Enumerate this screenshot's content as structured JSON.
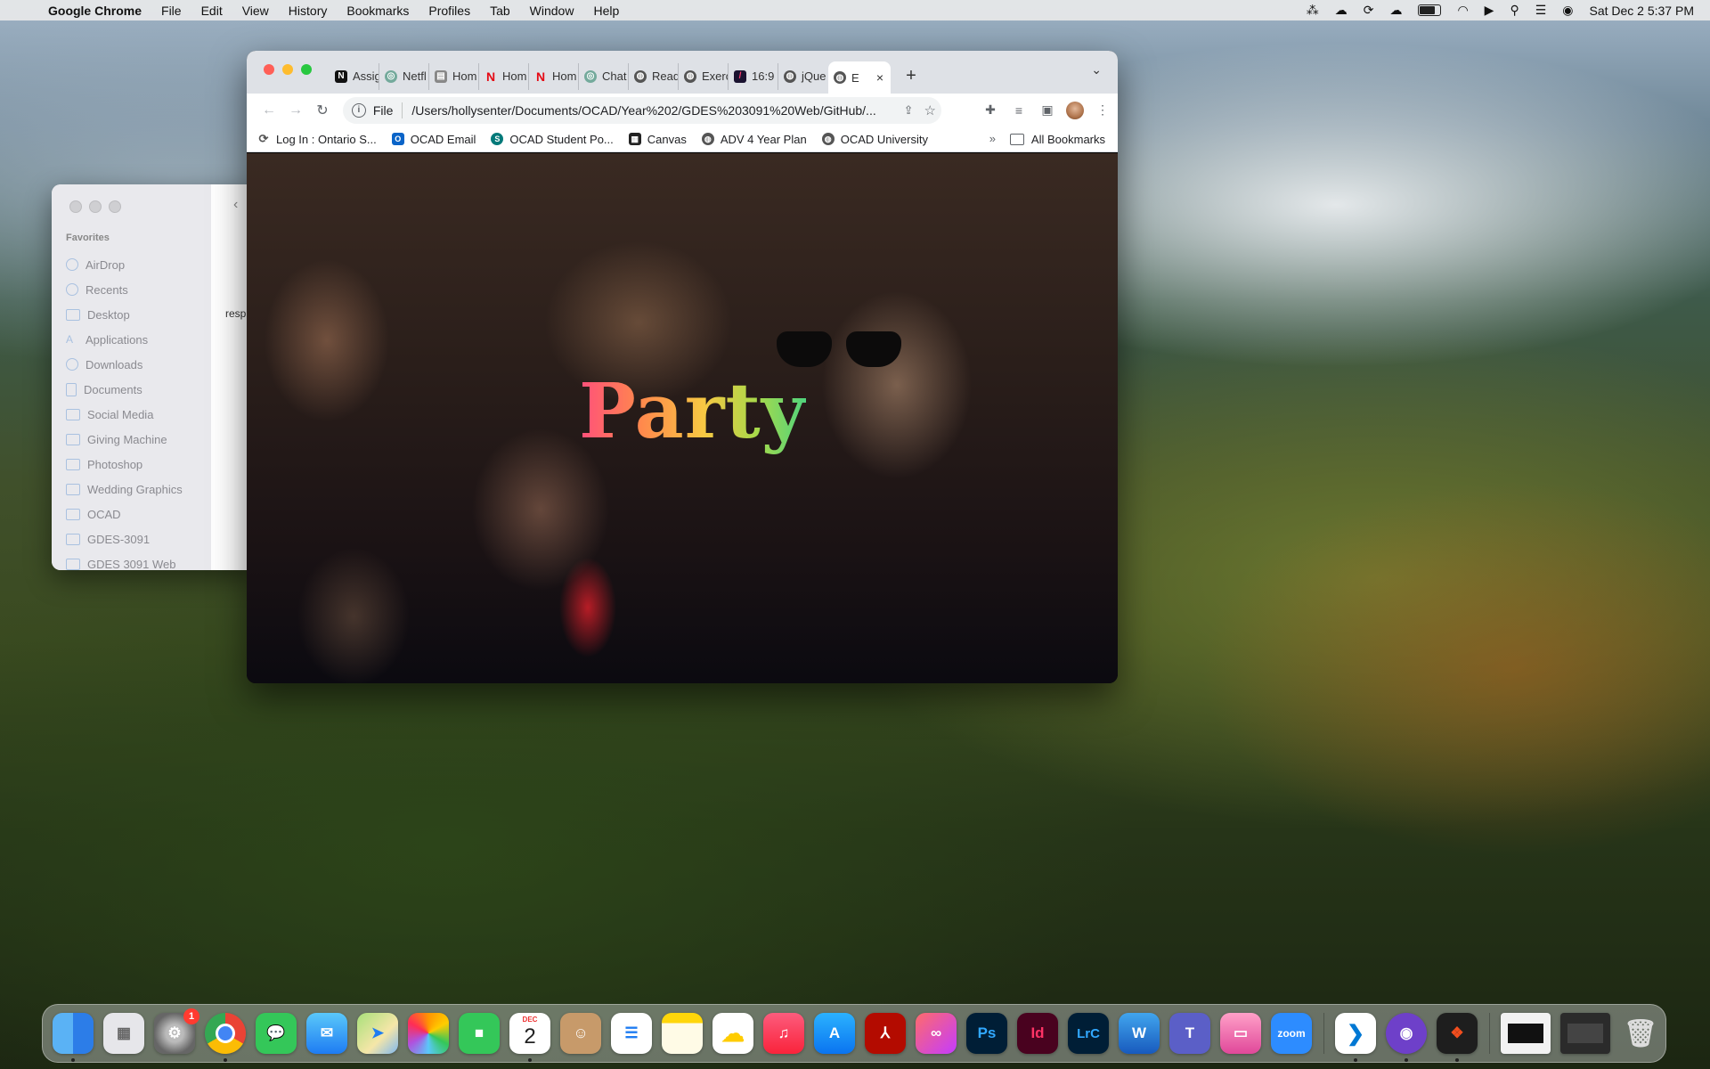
{
  "menubar": {
    "app_name": "Google Chrome",
    "items": [
      "File",
      "Edit",
      "View",
      "History",
      "Bookmarks",
      "Profiles",
      "Tab",
      "Window",
      "Help"
    ],
    "clock": "Sat Dec 2  5:37 PM"
  },
  "finder": {
    "favorites_heading": "Favorites",
    "sidebar_items": [
      "AirDrop",
      "Recents",
      "Desktop",
      "Applications",
      "Downloads",
      "Documents",
      "Social Media",
      "Giving Machine",
      "Photoshop",
      "Wedding Graphics",
      "OCAD",
      "GDES-3091",
      "GDES 3091 Web"
    ],
    "content_text": "resp"
  },
  "chrome": {
    "tabs": [
      {
        "label": "Assig",
        "icon": "notion-icon"
      },
      {
        "label": "Netfl",
        "icon": "chatgpt-icon"
      },
      {
        "label": "Hom",
        "icon": "page-icon"
      },
      {
        "label": "Hom",
        "icon": "netflix-icon"
      },
      {
        "label": "Hom",
        "icon": "netflix-icon"
      },
      {
        "label": "Chat",
        "icon": "chatgpt-icon"
      },
      {
        "label": "Read",
        "icon": "globe-icon"
      },
      {
        "label": "Exerc",
        "icon": "globe-icon"
      },
      {
        "label": "16:9",
        "icon": "slash-icon"
      },
      {
        "label": "jQue",
        "icon": "globe-icon"
      }
    ],
    "active_tab": {
      "label": "E",
      "icon": "globe-icon"
    },
    "address": {
      "scheme": "File",
      "url": "/Users/hollysenter/Documents/OCAD/Year%202/GDES%203091%20Web/GitHub/..."
    },
    "bookmarks": [
      {
        "label": "Log In : Ontario S...",
        "icon": "sync-icon"
      },
      {
        "label": "OCAD Email",
        "icon": "outlook-icon"
      },
      {
        "label": "OCAD Student Po...",
        "icon": "sharepoint-icon"
      },
      {
        "label": "Canvas",
        "icon": "canvas-icon"
      },
      {
        "label": "ADV 4 Year Plan",
        "icon": "globe-icon"
      },
      {
        "label": "OCAD University",
        "icon": "globe-icon"
      }
    ],
    "bookmarks_overflow": "»",
    "all_bookmarks": "All Bookmarks"
  },
  "page": {
    "heading": "Party"
  },
  "dock": {
    "apps": [
      "Finder",
      "Launchpad",
      "System Settings",
      "Google Chrome",
      "Messages",
      "Mail",
      "Maps",
      "Photos",
      "FaceTime",
      "Calendar",
      "Contacts",
      "Reminders",
      "Notes",
      "Weather",
      "Music",
      "App Store",
      "Adobe Acrobat",
      "Creative Cloud",
      "Photoshop",
      "InDesign",
      "Lightroom Classic",
      "Word",
      "Teams",
      "Keynote",
      "Zoom",
      "VS Code",
      "GitHub Desktop",
      "Figma"
    ],
    "settings_badge": "1",
    "calendar_month": "DEC",
    "calendar_day": "2",
    "ps_label": "Ps",
    "id_label": "Id",
    "lrc_label": "LrC",
    "word_label": "W",
    "zoom_label": "zoom"
  },
  "colors": {
    "close": "#ff5f57",
    "minimize": "#febc2e",
    "zoom": "#28c840",
    "title_gradient": [
      "#ff4f7b",
      "#ff8a4c",
      "#f7c843",
      "#a9d94a",
      "#4fd47d"
    ]
  }
}
